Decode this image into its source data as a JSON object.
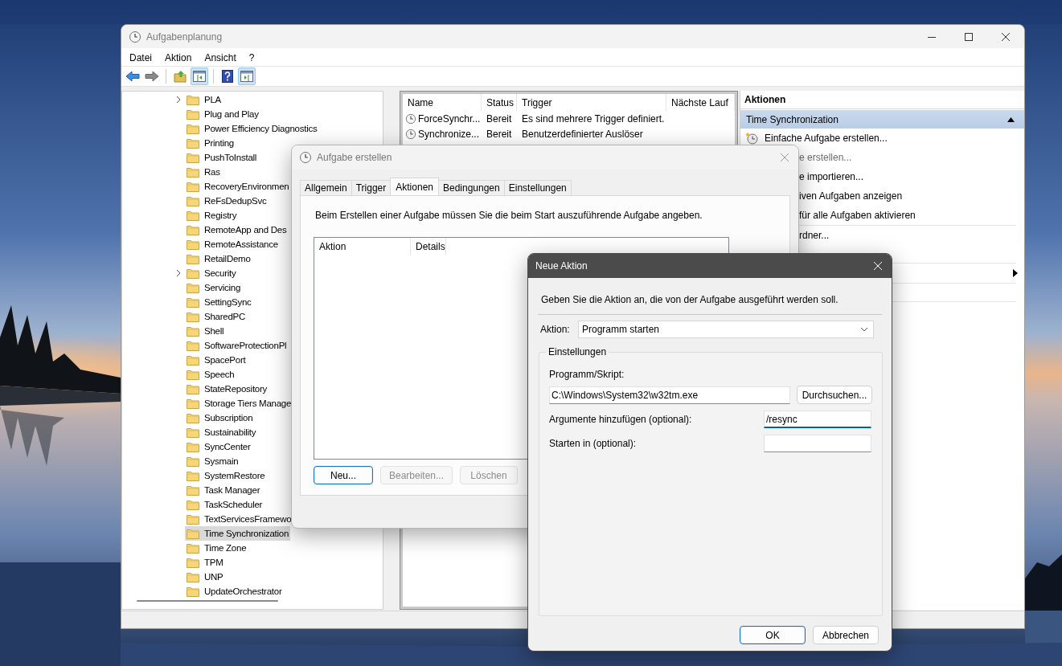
{
  "window": {
    "title": "Aufgabenplanung",
    "menu": [
      "Datei",
      "Aktion",
      "Ansicht",
      "?"
    ],
    "toolbar": [
      {
        "kind": "back",
        "pressed": false
      },
      {
        "kind": "forward",
        "pressed": false
      },
      {
        "kind": "separator"
      },
      {
        "kind": "folder-up",
        "pressed": false
      },
      {
        "kind": "tree-toggle",
        "pressed": true
      },
      {
        "kind": "separator"
      },
      {
        "kind": "help",
        "pressed": false
      },
      {
        "kind": "pane-toggle",
        "pressed": true
      }
    ]
  },
  "tree": {
    "items": [
      {
        "label": "PLA",
        "expandable": true,
        "selected": false
      },
      {
        "label": "Plug and Play",
        "expandable": false,
        "selected": false
      },
      {
        "label": "Power Efficiency Diagnostics",
        "expandable": false,
        "selected": false
      },
      {
        "label": "Printing",
        "expandable": false,
        "selected": false
      },
      {
        "label": "PushToInstall",
        "expandable": false,
        "selected": false
      },
      {
        "label": "Ras",
        "expandable": false,
        "selected": false
      },
      {
        "label": "RecoveryEnvironmen",
        "expandable": false,
        "selected": false
      },
      {
        "label": "ReFsDedupSvc",
        "expandable": false,
        "selected": false
      },
      {
        "label": "Registry",
        "expandable": false,
        "selected": false
      },
      {
        "label": "RemoteApp and Des",
        "expandable": false,
        "selected": false
      },
      {
        "label": "RemoteAssistance",
        "expandable": false,
        "selected": false
      },
      {
        "label": "RetailDemo",
        "expandable": false,
        "selected": false
      },
      {
        "label": "Security",
        "expandable": true,
        "selected": false
      },
      {
        "label": "Servicing",
        "expandable": false,
        "selected": false
      },
      {
        "label": "SettingSync",
        "expandable": false,
        "selected": false
      },
      {
        "label": "SharedPC",
        "expandable": false,
        "selected": false
      },
      {
        "label": "Shell",
        "expandable": false,
        "selected": false
      },
      {
        "label": "SoftwareProtectionPl",
        "expandable": false,
        "selected": false
      },
      {
        "label": "SpacePort",
        "expandable": false,
        "selected": false
      },
      {
        "label": "Speech",
        "expandable": false,
        "selected": false
      },
      {
        "label": "StateRepository",
        "expandable": false,
        "selected": false
      },
      {
        "label": "Storage Tiers Manage",
        "expandable": false,
        "selected": false
      },
      {
        "label": "Subscription",
        "expandable": false,
        "selected": false
      },
      {
        "label": "Sustainability",
        "expandable": false,
        "selected": false
      },
      {
        "label": "SyncCenter",
        "expandable": false,
        "selected": false
      },
      {
        "label": "Sysmain",
        "expandable": false,
        "selected": false
      },
      {
        "label": "SystemRestore",
        "expandable": false,
        "selected": false
      },
      {
        "label": "Task Manager",
        "expandable": false,
        "selected": false
      },
      {
        "label": "TaskScheduler",
        "expandable": false,
        "selected": false
      },
      {
        "label": "TextServicesFramewo",
        "expandable": false,
        "selected": false
      },
      {
        "label": "Time Synchronization",
        "expandable": false,
        "selected": true
      },
      {
        "label": "Time Zone",
        "expandable": false,
        "selected": false
      },
      {
        "label": "TPM",
        "expandable": false,
        "selected": false
      },
      {
        "label": "UNP",
        "expandable": false,
        "selected": false
      },
      {
        "label": "UpdateOrchestrator",
        "expandable": false,
        "selected": false
      }
    ]
  },
  "task_list": {
    "columns": [
      "Name",
      "Status",
      "Trigger",
      "Nächste Lauf"
    ],
    "rows": [
      {
        "name": "ForceSynchr...",
        "status": "Bereit",
        "trigger": "Es sind mehrere Trigger definiert."
      },
      {
        "name": "Synchronize...",
        "status": "Bereit",
        "trigger": "Benutzerdefinierter Auslöser"
      }
    ]
  },
  "actions_pane": {
    "title": "Aktionen",
    "section": "Time Synchronization",
    "items": [
      {
        "kind": "action",
        "label": "Einfache Aufgabe erstellen...",
        "covered": false,
        "disabled": false
      },
      {
        "kind": "action",
        "label": "e erstellen...",
        "covered": true,
        "disabled": true
      },
      {
        "kind": "action",
        "label": "e importieren...",
        "covered": true,
        "disabled": false
      },
      {
        "kind": "action",
        "label": "iven Aufgaben anzeigen",
        "covered": true,
        "disabled": false
      },
      {
        "kind": "action",
        "label": "für alle Aufgaben aktivieren",
        "covered": true,
        "disabled": false
      },
      {
        "kind": "separator"
      },
      {
        "kind": "action",
        "label": "rdner...",
        "covered": true,
        "disabled": false
      },
      {
        "kind": "blank"
      },
      {
        "kind": "separator"
      },
      {
        "kind": "submenu"
      },
      {
        "kind": "separator"
      },
      {
        "kind": "blank"
      },
      {
        "kind": "separator"
      }
    ]
  },
  "create_task_dialog": {
    "title": "Aufgabe erstellen",
    "tabs": [
      {
        "label": "Allgemein",
        "selected": false
      },
      {
        "label": "Trigger",
        "selected": false
      },
      {
        "label": "Aktionen",
        "selected": true
      },
      {
        "label": "Bedingungen",
        "selected": false
      },
      {
        "label": "Einstellungen",
        "selected": false
      }
    ],
    "hint": "Beim Erstellen einer Aufgabe müssen Sie die beim Start auszuführende Aufgabe angeben.",
    "columns": [
      "Aktion",
      "Details"
    ],
    "buttons": [
      {
        "label": "Neu...",
        "default": true,
        "disabled": false
      },
      {
        "label": "Bearbeiten...",
        "default": false,
        "disabled": true
      },
      {
        "label": "Löschen",
        "default": false,
        "disabled": true
      }
    ]
  },
  "new_action_dialog": {
    "title": "Neue Aktion",
    "hint": "Geben Sie die Aktion an, die von der Aufgabe ausgeführt werden soll.",
    "action_label": "Aktion:",
    "action_value": "Programm starten",
    "group_label": "Einstellungen",
    "program_label": "Programm/Skript:",
    "program_value": "C:\\Windows\\System32\\w32tm.exe",
    "browse_button": "Durchsuchen...",
    "fields": [
      {
        "label": "Argumente hinzufügen (optional):",
        "value": "/resync",
        "focused": true
      },
      {
        "label": "Starten in (optional):",
        "focused": false
      }
    ],
    "buttons": [
      {
        "label": "OK",
        "default": true
      },
      {
        "label": "Abbrechen",
        "default": false
      }
    ]
  }
}
